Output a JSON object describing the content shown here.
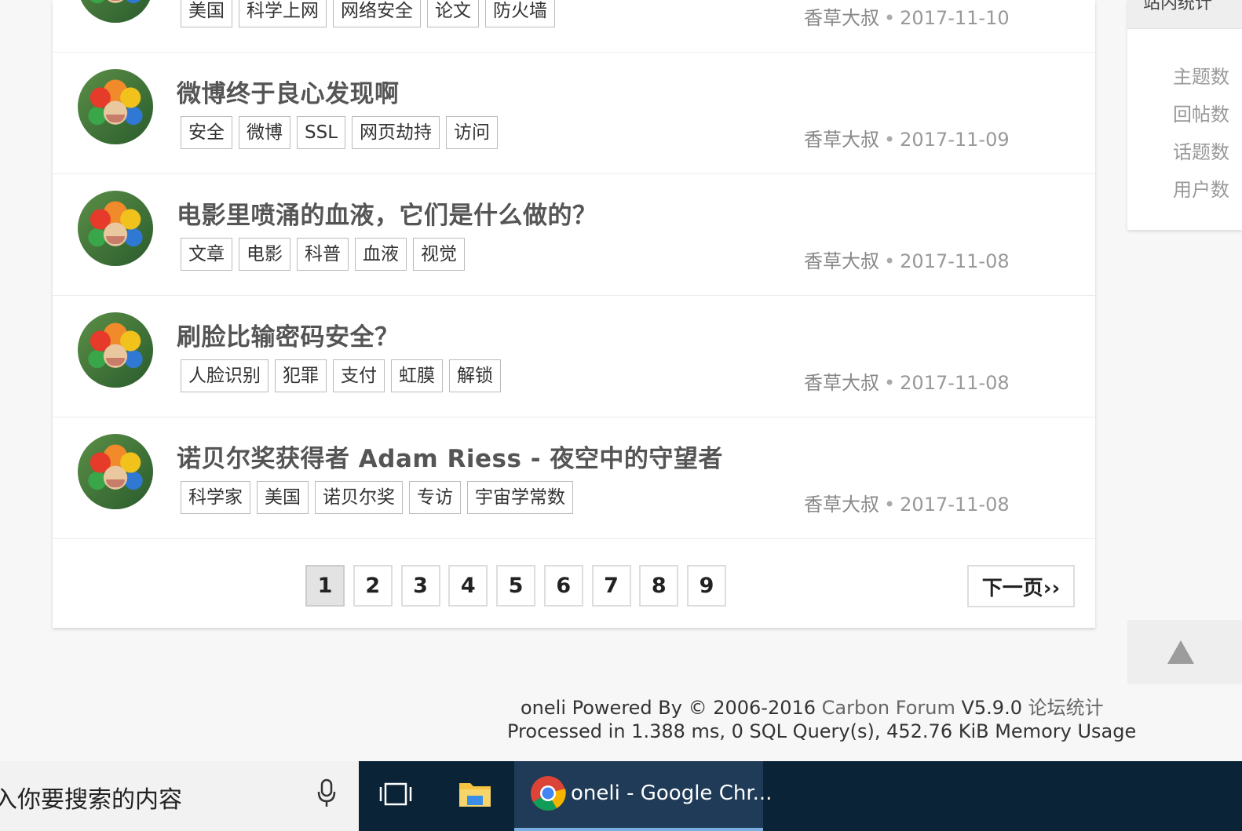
{
  "topics": [
    {
      "title": "",
      "tags": [
        "美国",
        "科学上网",
        "网络安全",
        "论文",
        "防火墙"
      ],
      "author": "香草大叔",
      "date": "2017-11-10"
    },
    {
      "title": "微博终于良心发现啊",
      "tags": [
        "安全",
        "微博",
        "SSL",
        "网页劫持",
        "访问"
      ],
      "author": "香草大叔",
      "date": "2017-11-09"
    },
    {
      "title": "电影里喷涌的血液，它们是什么做的？",
      "tags": [
        "文章",
        "电影",
        "科普",
        "血液",
        "视觉"
      ],
      "author": "香草大叔",
      "date": "2017-11-08"
    },
    {
      "title": "刷脸比输密码安全？",
      "tags": [
        "人脸识别",
        "犯罪",
        "支付",
        "虹膜",
        "解锁"
      ],
      "author": "香草大叔",
      "date": "2017-11-08"
    },
    {
      "title": "诺贝尔奖获得者 Adam Riess - 夜空中的守望者",
      "tags": [
        "科学家",
        "美国",
        "诺贝尔奖",
        "专访",
        "宇宙学常数"
      ],
      "author": "香草大叔",
      "date": "2017-11-08"
    }
  ],
  "meta_separator": "•",
  "pagination": {
    "pages": [
      "1",
      "2",
      "3",
      "4",
      "5",
      "6",
      "7",
      "8",
      "9"
    ],
    "current": "1",
    "next_label": "下一页››"
  },
  "sidebar": {
    "title": "站内统计",
    "stats": [
      "主题数",
      "回帖数",
      "话题数",
      "用户数"
    ]
  },
  "footer": {
    "line1_prefix": "oneli Powered By © 2006-2016 ",
    "carbon_link": "Carbon Forum",
    "version": " V5.9.0 ",
    "stats_link": "论坛统计",
    "line2": "Processed in 1.388 ms, 0 SQL Query(s), 452.76 KiB Memory Usage"
  },
  "taskbar": {
    "search_placeholder": "入你要搜索的内容",
    "chrome_label": "oneli - Google Chr..."
  },
  "colors": {
    "taskbar": "#0b2336",
    "accent": "#7aaee0"
  }
}
